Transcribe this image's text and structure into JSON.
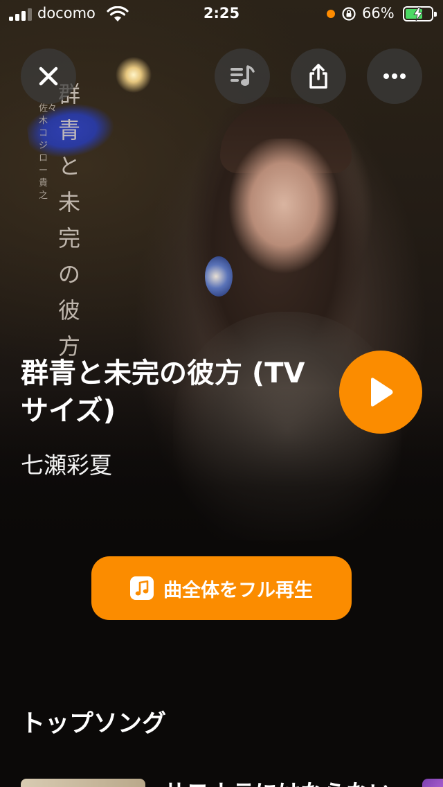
{
  "status_bar": {
    "carrier": "docomo",
    "time": "2:25",
    "battery_percent": "66%",
    "battery_level": 0.66,
    "signal_bars": 3
  },
  "header": {
    "close_icon": "close-icon",
    "queue_icon": "music-queue-icon",
    "share_icon": "share-icon",
    "more_icon": "more-icon"
  },
  "cover_art": {
    "title_text": "群青と未完の彼方",
    "credit_text": "佐々木コジロー貴之"
  },
  "song": {
    "title": "群青と未完の彼方 (TV サイズ)",
    "artist": "七瀬彩夏"
  },
  "actions": {
    "full_play_label": "曲全体をフル再生"
  },
  "top_songs": {
    "heading": "トップソング",
    "first_item_title": "サヨナラにはならない"
  },
  "colors": {
    "accent": "#fb8c00",
    "battery_green": "#4cd964",
    "background": "#0b0908"
  }
}
